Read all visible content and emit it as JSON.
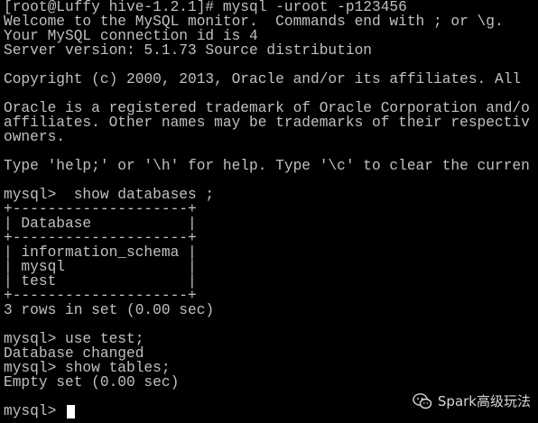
{
  "terminal": {
    "lines": [
      "[root@Luffy hive-1.2.1]# mysql -uroot -p123456",
      "Welcome to the MySQL monitor.  Commands end with ; or \\g.",
      "Your MySQL connection id is 4",
      "Server version: 5.1.73 Source distribution",
      "",
      "Copyright (c) 2000, 2013, Oracle and/or its affiliates. All",
      "",
      "Oracle is a registered trademark of Oracle Corporation and/o",
      "affiliates. Other names may be trademarks of their respectiv",
      "owners.",
      "",
      "Type 'help;' or '\\h' for help. Type '\\c' to clear the curren",
      "",
      "mysql>  show databases ;",
      "+--------------------+",
      "| Database           |",
      "+--------------------+",
      "| information_schema |",
      "| mysql              |",
      "| test               |",
      "+--------------------+",
      "3 rows in set (0.00 sec)",
      "",
      "mysql> use test;",
      "Database changed",
      "mysql> show tables;",
      "Empty set (0.00 sec)",
      ""
    ],
    "prompt": "mysql> "
  },
  "watermark": {
    "text": "Spark高级玩法",
    "icon": "wechat-icon"
  },
  "colors": {
    "background": "#000000",
    "text": "#c0c0c0",
    "cursor": "#ffffff"
  }
}
